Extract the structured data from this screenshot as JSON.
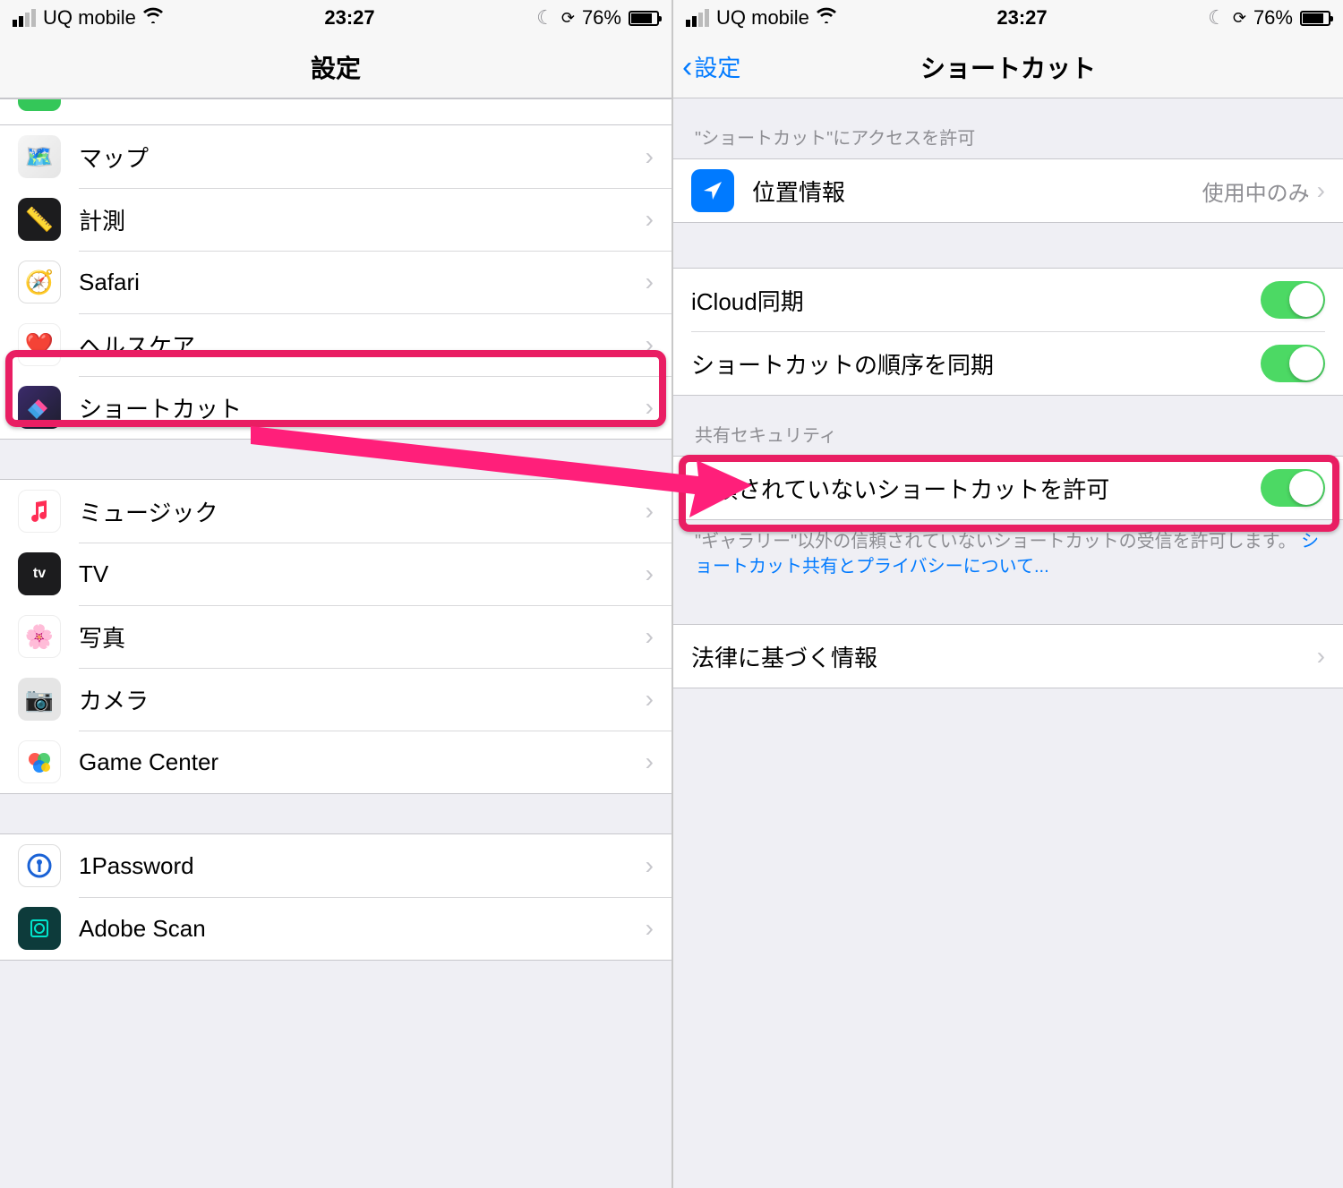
{
  "status": {
    "carrier": "UQ mobile",
    "time": "23:27",
    "battery_pct": "76%"
  },
  "left": {
    "title": "設定",
    "rows": {
      "maps": "マップ",
      "measure": "計測",
      "safari": "Safari",
      "health": "ヘルスケア",
      "shortcuts": "ショートカット",
      "music": "ミュージック",
      "tv": "TV",
      "photos": "写真",
      "camera": "カメラ",
      "gamecenter": "Game Center",
      "onepassword": "1Password",
      "adobescan": "Adobe Scan"
    }
  },
  "right": {
    "back_label": "設定",
    "title": "ショートカット",
    "section_access": "\"ショートカット\"にアクセスを許可",
    "location_label": "位置情報",
    "location_value": "使用中のみ",
    "icloud_sync": "iCloud同期",
    "order_sync": "ショートカットの順序を同期",
    "section_security": "共有セキュリティ",
    "allow_untrusted": "信頼されていないショートカットを許可",
    "footer_text": "\"ギャラリー\"以外の信頼されていないショートカットの受信を許可します。 ",
    "footer_link": "ショートカット共有とプライバシーについて...",
    "legal": "法律に基づく情報"
  }
}
